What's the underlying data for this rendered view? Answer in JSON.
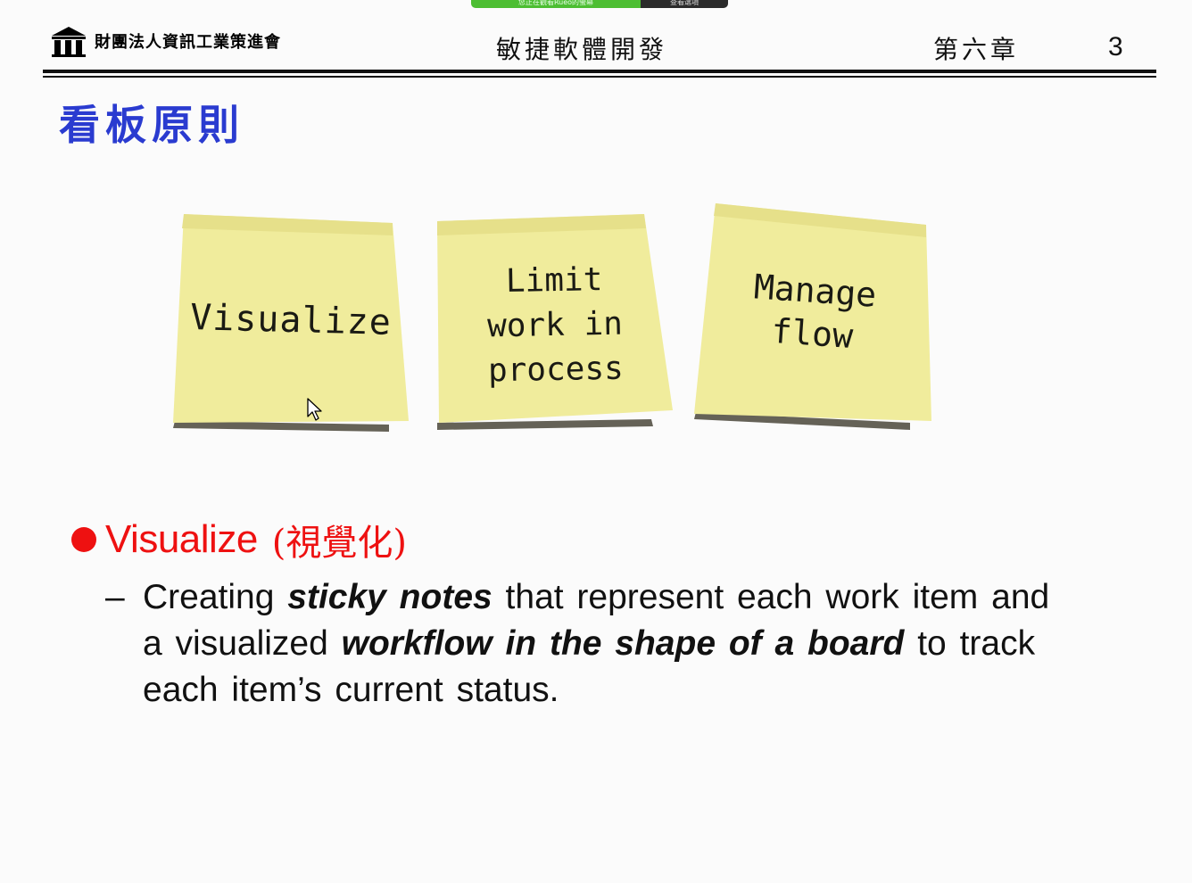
{
  "screen_share": {
    "status_text": "您正在觀看Rueo的螢幕",
    "stop_text": "查看選項"
  },
  "header": {
    "org_name": "財團法人資訊工業策進會",
    "course_title": "敏捷軟體開發",
    "chapter": "第六章",
    "page_number": "3"
  },
  "slide": {
    "title": "看板原則",
    "sticky_notes": [
      {
        "lines": [
          "Visualize"
        ]
      },
      {
        "lines": [
          "Limit",
          "work in",
          "process"
        ]
      },
      {
        "lines": [
          "Manage",
          "flow"
        ]
      }
    ],
    "bullet": {
      "heading": "Visualize",
      "heading_cjk": "(視覺化)",
      "dash": "–",
      "line1_a": "Creating",
      "line1_b": "sticky notes",
      "line1_c": "that represent each work item and",
      "line2_a": "a visualized",
      "line2_b": "workflow in the shape of a board",
      "line2_c": "to track",
      "line3": "each item’s current status."
    }
  },
  "colors": {
    "title_blue": "#2a3bd0",
    "bullet_red": "#ee1111",
    "sticky_yellow": "#f0ec9c"
  }
}
